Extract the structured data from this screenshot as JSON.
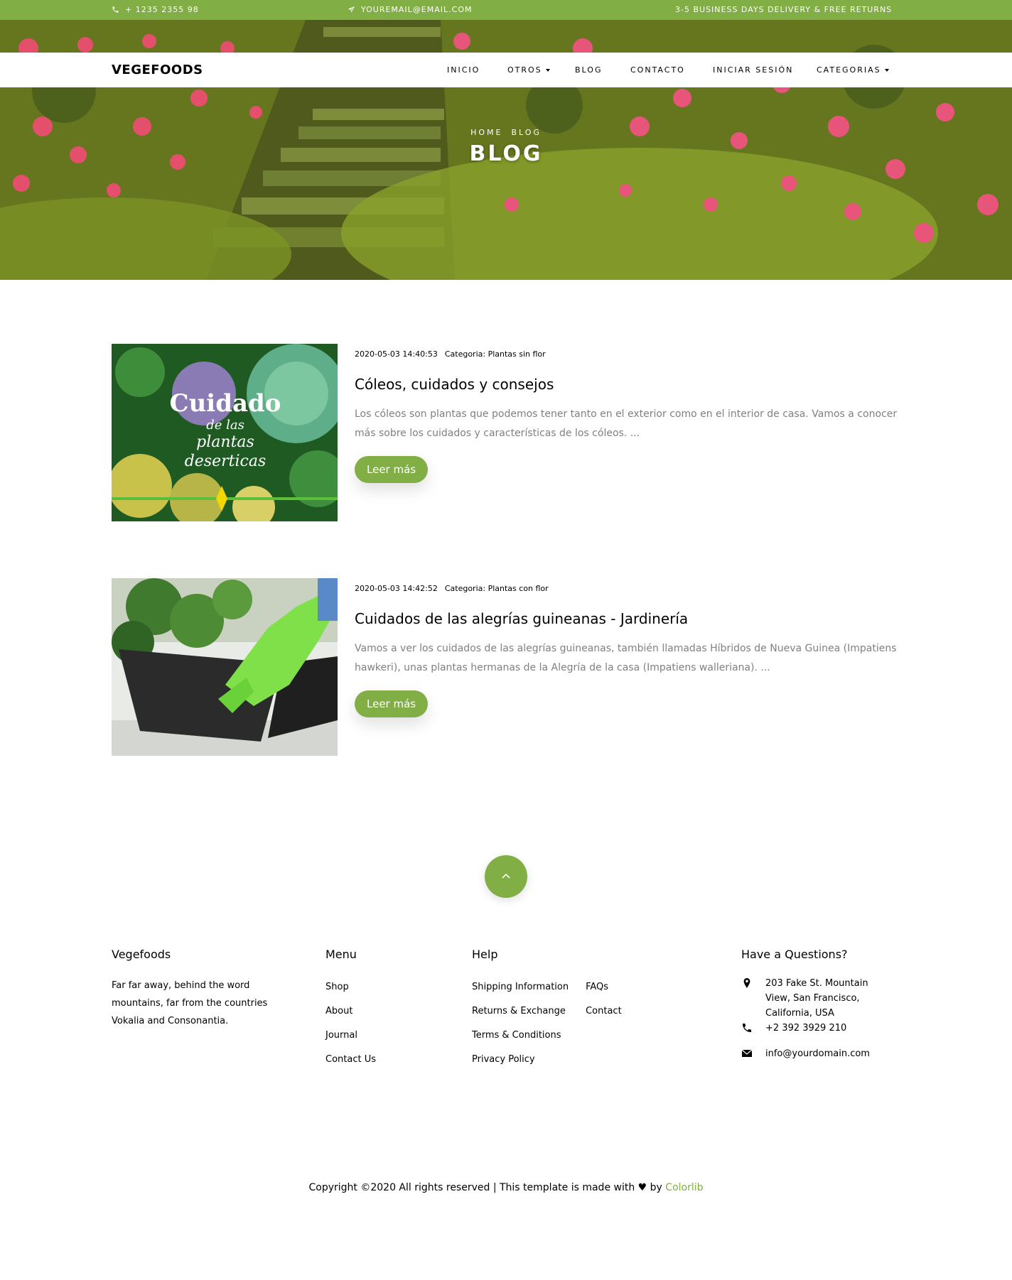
{
  "topbar": {
    "phone": "+ 1235 2355 98",
    "email": "YOUREMAIL@EMAIL.COM",
    "shipping": "3-5 BUSINESS DAYS DELIVERY & FREE RETURNS"
  },
  "navbar": {
    "brand": "VEGEFOODS",
    "items": [
      "INICIO",
      "OTROS",
      "BLOG",
      "CONTACTO",
      "INICIAR SESIÓN",
      "CATEGORIAS"
    ]
  },
  "hero": {
    "breadcrumb": [
      "HOME",
      "BLOG"
    ],
    "title": "BLOG"
  },
  "posts": [
    {
      "date": "2020-05-03 14:40:53",
      "category": "Categoria: Plantas sin flor",
      "title": "Cóleos, cuidados y consejos",
      "excerpt": "Los cóleos son plantas que podemos tener tanto en el exterior como en el interior de casa. Vamos a conocer más sobre los cuidados y características de los cóleos. ...",
      "button": "Leer más",
      "image_text": [
        "Cuidado",
        "de las",
        "plantas",
        "deserticas"
      ]
    },
    {
      "date": "2020-05-03 14:42:52",
      "category": "Categoria: Plantas con flor",
      "title": "Cuidados de las alegrías guineanas - Jardinería",
      "excerpt": "Vamos a ver los cuidados de las alegrías guineanas, también llamadas Híbridos de Nueva Guinea (Impatiens hawkeri), unas plantas hermanas de la Alegría de la casa (Impatiens walleriana). ...",
      "button": "Leer más"
    }
  ],
  "footer": {
    "about": {
      "title": "Vegefoods",
      "text": "Far far away, behind the word mountains, far from the countries Vokalia and Consonantia."
    },
    "menu": {
      "title": "Menu",
      "links": [
        "Shop",
        "About",
        "Journal",
        "Contact Us"
      ]
    },
    "help": {
      "title": "Help",
      "links_left": [
        "Shipping Information",
        "Returns & Exchange",
        "Terms & Conditions",
        "Privacy Policy"
      ],
      "links_right": [
        "FAQs",
        "Contact"
      ]
    },
    "contact": {
      "title": "Have a Questions?",
      "address": "203 Fake St. Mountain View, San Francisco, California, USA",
      "phone": "+2 392 3929 210",
      "email": "info@yourdomain.com"
    },
    "copyright_prefix": "Copyright ©2020 All rights reserved | This template is made with",
    "copyright_by": "by",
    "copyright_brand": "Colorlib"
  },
  "colors": {
    "accent": "#82ae46"
  }
}
